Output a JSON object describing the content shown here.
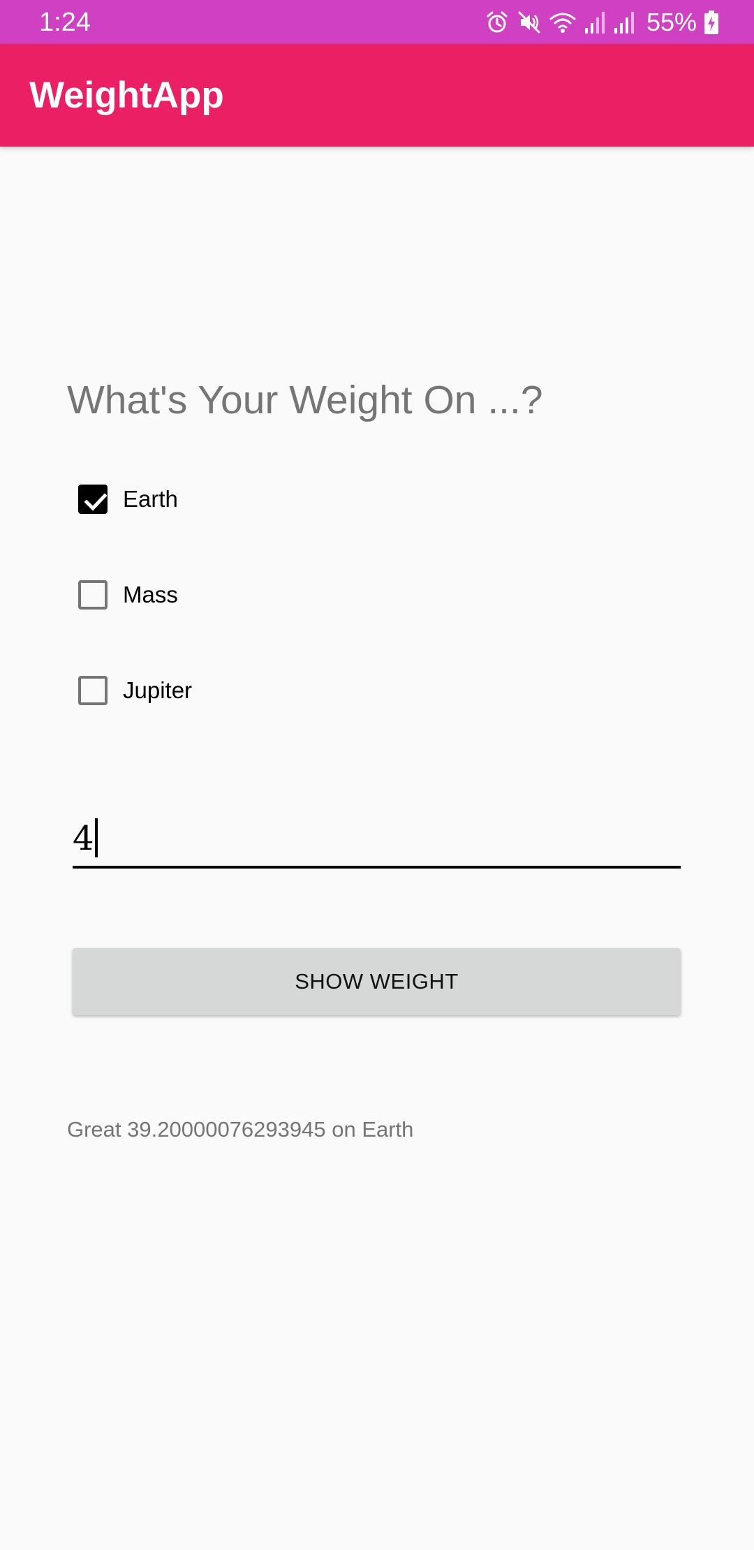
{
  "status_bar": {
    "time": "1:24",
    "battery_percent": "55%",
    "icons": [
      "alarm-icon",
      "mute-icon",
      "wifi-icon",
      "signal-icon",
      "signal-icon",
      "battery-charging-icon"
    ],
    "background_color": "#cf41c2"
  },
  "app_bar": {
    "title": "WeightApp",
    "background_color": "#eb1f64"
  },
  "question": "What's Your Weight On ...?",
  "planets": [
    {
      "label": "Earth",
      "checked": true
    },
    {
      "label": "Mass",
      "checked": false
    },
    {
      "label": "Jupiter",
      "checked": false
    }
  ],
  "weight_input": {
    "value": "4"
  },
  "show_button": {
    "label": "SHOW WEIGHT"
  },
  "result": "Great 39.20000076293945 on Earth"
}
